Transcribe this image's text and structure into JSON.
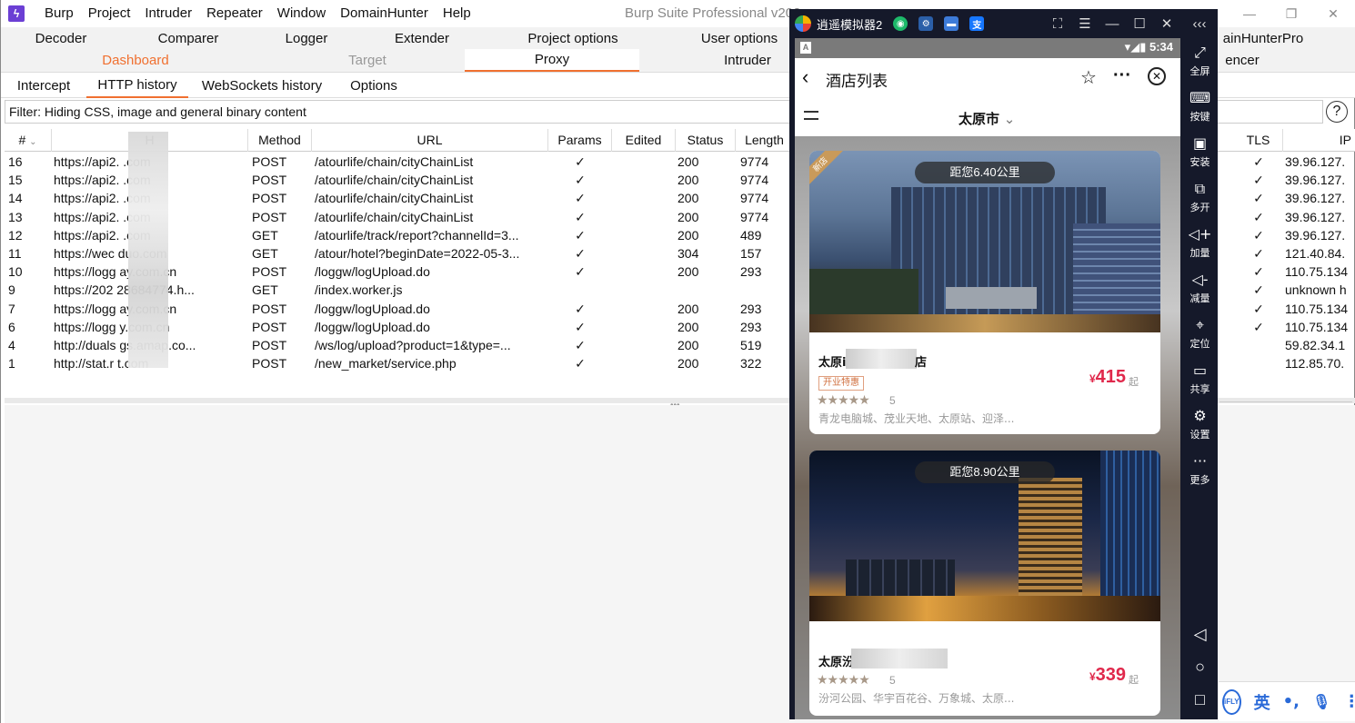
{
  "window": {
    "title": "Burp Suite Professional v202",
    "menu": [
      "Burp",
      "Project",
      "Intruder",
      "Repeater",
      "Window",
      "DomainHunter",
      "Help"
    ],
    "controls": [
      "—",
      "❐",
      "✕"
    ]
  },
  "tabs_row1": {
    "decoder": "Decoder",
    "comparer": "Comparer",
    "logger": "Logger",
    "extender": "Extender",
    "project_options": "Project options",
    "user_options": "User options",
    "domainhunter_pro": "ainHunterPro"
  },
  "tabs_row2": {
    "dashboard": "Dashboard",
    "target": "Target",
    "proxy": "Proxy",
    "intruder": "Intruder",
    "sequencer": "encer"
  },
  "proxy_tabs": {
    "intercept": "Intercept",
    "http_history": "HTTP history",
    "websockets_history": "WebSockets history",
    "options": "Options"
  },
  "filter": {
    "text": "Filter: Hiding CSS, image and general binary content",
    "help": "?"
  },
  "table": {
    "columns": {
      "num": "#",
      "host": "H",
      "method": "Method",
      "url": "URL",
      "params": "Params",
      "edited": "Edited",
      "status": "Status",
      "length": "Length",
      "tls": "TLS",
      "ip": "IP"
    },
    "rows": [
      {
        "num": "16",
        "host": "https://api2.       .com",
        "method": "POST",
        "url": "/atourlife/chain/cityChainList",
        "params": "✓",
        "status": "200",
        "length": "9774",
        "tls": "✓",
        "ip": "39.96.127."
      },
      {
        "num": "15",
        "host": "https://api2.       .com",
        "method": "POST",
        "url": "/atourlife/chain/cityChainList",
        "params": "✓",
        "status": "200",
        "length": "9774",
        "tls": "✓",
        "ip": "39.96.127."
      },
      {
        "num": "14",
        "host": "https://api2.       .com",
        "method": "POST",
        "url": "/atourlife/chain/cityChainList",
        "params": "✓",
        "status": "200",
        "length": "9774",
        "tls": "✓",
        "ip": "39.96.127."
      },
      {
        "num": "13",
        "host": "https://api2.       .com",
        "method": "POST",
        "url": "/atourlife/chain/cityChainList",
        "params": "✓",
        "status": "200",
        "length": "9774",
        "tls": "✓",
        "ip": "39.96.127."
      },
      {
        "num": "12",
        "host": "https://api2.       .com",
        "method": "GET",
        "url": "/atourlife/track/report?channelId=3...",
        "params": "✓",
        "status": "200",
        "length": "489",
        "tls": "✓",
        "ip": "39.96.127."
      },
      {
        "num": "11",
        "host": "https://wec      duo.com",
        "method": "GET",
        "url": "/atour/hotel?beginDate=2022-05-3...",
        "params": "✓",
        "status": "304",
        "length": "157",
        "tls": "✓",
        "ip": "121.40.84."
      },
      {
        "num": "10",
        "host": "https://logg      ay.com.cn",
        "method": "POST",
        "url": "/loggw/logUpload.do",
        "params": "✓",
        "status": "200",
        "length": "293",
        "tls": "✓",
        "ip": "110.75.134"
      },
      {
        "num": "9",
        "host": "https://202       28684774.h...",
        "method": "GET",
        "url": "/index.worker.js",
        "params": "",
        "status": "",
        "length": "",
        "tls": "✓",
        "ip": "unknown h"
      },
      {
        "num": "7",
        "host": "https://logg      ay.com.cn",
        "method": "POST",
        "url": "/loggw/logUpload.do",
        "params": "✓",
        "status": "200",
        "length": "293",
        "tls": "✓",
        "ip": "110.75.134"
      },
      {
        "num": "6",
        "host": "https://logg      y.com.cn",
        "method": "POST",
        "url": "/loggw/logUpload.do",
        "params": "✓",
        "status": "200",
        "length": "293",
        "tls": "✓",
        "ip": "110.75.134"
      },
      {
        "num": "4",
        "host": "http://duals      gs.amap.co...",
        "method": "POST",
        "url": "/ws/log/upload?product=1&type=...",
        "params": "✓",
        "status": "200",
        "length": "519",
        "tls": "",
        "ip": "59.82.34.1"
      },
      {
        "num": "1",
        "host": "http://stat.r      t.com",
        "method": "POST",
        "url": "/new_market/service.php",
        "params": "✓",
        "status": "200",
        "length": "322",
        "tls": "",
        "ip": "112.85.70."
      }
    ]
  },
  "emulator": {
    "title": "逍遥模拟器2",
    "status_time": "5:34",
    "page_title": "酒店列表",
    "city": "太原市",
    "cards": [
      {
        "distance": "距您6.40公里",
        "ribbon": "新店",
        "name": "太原i",
        "name_suffix": "店",
        "promo": "开业特惠",
        "stars": "★★★★★",
        "rating": "5",
        "area": "青龙电脑城、茂业天地、太原站、迎泽...",
        "currency": "¥",
        "price": "415",
        "price_suffix": "起"
      },
      {
        "distance": "距您8.90公里",
        "name": "太原汾",
        "promo": "",
        "stars": "★★★★★",
        "rating": "5",
        "area": "汾河公园、华宇百花谷、万象城、太原...",
        "currency": "¥",
        "price": "339",
        "price_suffix": "起"
      }
    ],
    "sidebar": [
      {
        "icon": "⤢",
        "label": "全屏"
      },
      {
        "icon": "⌨",
        "label": "按键"
      },
      {
        "icon": "▣",
        "label": "安装"
      },
      {
        "icon": "⧉",
        "label": "多开"
      },
      {
        "icon": "◁+",
        "label": "加量"
      },
      {
        "icon": "◁-",
        "label": "减量"
      },
      {
        "icon": "⌖",
        "label": "定位"
      },
      {
        "icon": "▭",
        "label": "共享"
      },
      {
        "icon": "⚙",
        "label": "设置"
      },
      {
        "icon": "···",
        "label": "更多"
      }
    ]
  },
  "ime": {
    "logo": "iFLY",
    "lang": "英",
    "punct": "•,",
    "mic": "🎙",
    "more": "⋮"
  },
  "colors": {
    "accent": "#f07030",
    "price": "#e0284b",
    "emulator_bg": "#15192a"
  }
}
